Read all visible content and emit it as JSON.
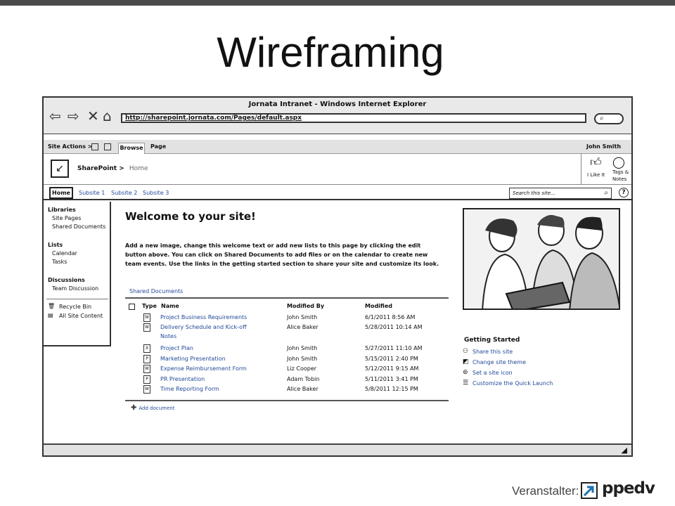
{
  "slide": {
    "title": "Wireframing",
    "footer_label": "Veranstalter:",
    "footer_logo_text": "ppedv"
  },
  "browser": {
    "window_title": "Jornata Intranet - Windows Internet Explorer",
    "address": "http://sharepoint.jornata.com/Pages/default.aspx",
    "nav_icons": [
      "back-arrow-icon",
      "forward-arrow-icon",
      "stop-icon",
      "home-icon"
    ]
  },
  "ribbon": {
    "site_actions": "Site Actions >",
    "tabs": [
      "Browse",
      "Page"
    ],
    "user": "John Smith"
  },
  "header": {
    "site_name": "SharePoint >",
    "breadcrumb_home": "Home",
    "like_label": "I Like It",
    "tags_label_1": "Tags &",
    "tags_label_2": "Notes"
  },
  "topnav": {
    "items": [
      "Home",
      "Subsite 1",
      "Subsite 2",
      "Subsite 3"
    ],
    "search_placeholder": "Search this site...",
    "help": "?"
  },
  "quicklaunch": {
    "libraries_heading": "Libraries",
    "libraries": [
      "Site Pages",
      "Shared Documents"
    ],
    "lists_heading": "Lists",
    "lists": [
      "Calendar",
      "Tasks"
    ],
    "discussions_heading": "Discussions",
    "discussions": [
      "Team Discussion"
    ],
    "recycle_bin": "Recycle Bin",
    "all_site_content": "All Site Content"
  },
  "main": {
    "welcome_title": "Welcome to your site!",
    "welcome_text": "Add a new image, change this welcome text or add new lists to this page by clicking the edit button above. You can click on Shared Documents to add files or on the calendar to create new team events. Use the links in the getting started section to share your site and customize its look.",
    "library_title": "Shared Documents",
    "columns": [
      "Type",
      "Name",
      "Modified By",
      "Modified"
    ],
    "rows": [
      {
        "type": "W",
        "name": "Project Business Requirements",
        "by": "John Smith",
        "modified": "6/1/2011 8:56 AM"
      },
      {
        "type": "W",
        "name": "Delivery Schedule and Kick-off",
        "name2": "Notes",
        "by": "Alice Baker",
        "modified": "5/28/2011 10:14 AM"
      },
      {
        "type": "X",
        "name": "Project Plan",
        "by": "John Smith",
        "modified": "5/27/2011 11:10 AM"
      },
      {
        "type": "P",
        "name": "Marketing Presentation",
        "by": "John Smith",
        "modified": "5/15/2011 2:40 PM"
      },
      {
        "type": "W",
        "name": "Expense Reimbursement Form",
        "by": "Liz Cooper",
        "modified": "5/12/2011 9:15 AM"
      },
      {
        "type": "P",
        "name": "PR Presentation",
        "by": "Adam Tobin",
        "modified": "5/11/2011 3:41 PM"
      },
      {
        "type": "W",
        "name": "Time Reporting Form",
        "by": "Alice Baker",
        "modified": "5/8/2011 12:15 PM"
      }
    ],
    "add_document": "Add document"
  },
  "getting_started": {
    "title": "Getting Started",
    "items": [
      "Share this site",
      "Change site theme",
      "Set a site icon",
      "Customize the Quick Launch"
    ]
  }
}
